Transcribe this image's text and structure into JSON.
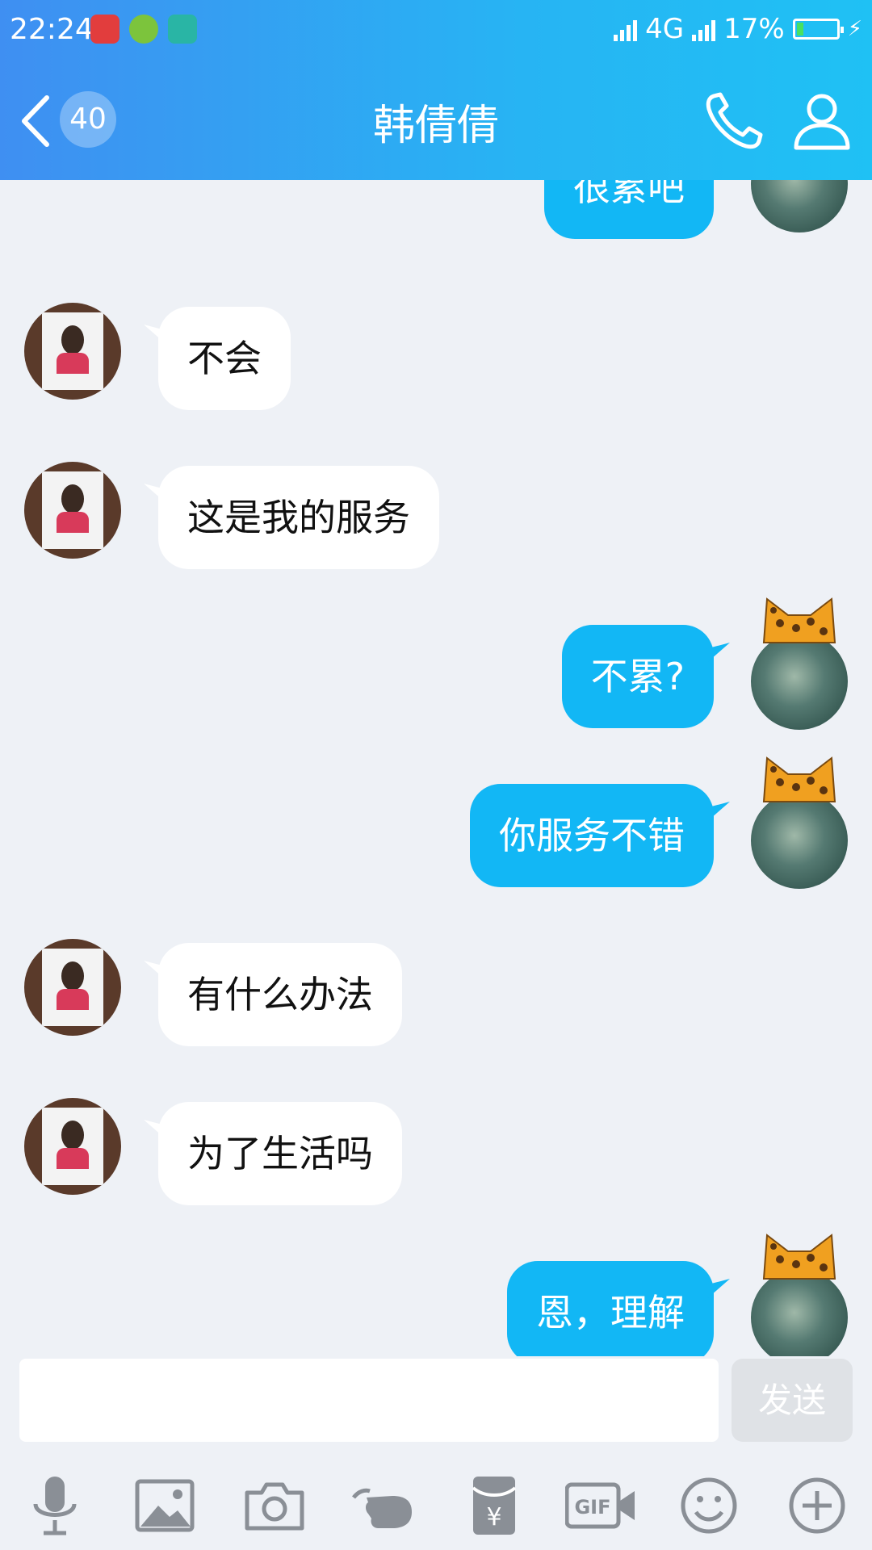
{
  "status_bar": {
    "time": "22:24",
    "network_label": "4G",
    "battery_percent": "17%",
    "battery_level": 0.17
  },
  "nav": {
    "unread_count": "40",
    "title": "韩倩倩"
  },
  "messages": [
    {
      "side": "out",
      "text": "很累吧"
    },
    {
      "side": "in",
      "text": "不会"
    },
    {
      "side": "in",
      "text": "这是我的服务"
    },
    {
      "side": "out",
      "text": "不累?"
    },
    {
      "side": "out",
      "text": "你服务不错"
    },
    {
      "side": "in",
      "text": "有什么办法"
    },
    {
      "side": "in",
      "text": "为了生活吗"
    },
    {
      "side": "out",
      "text": "恩，理解"
    }
  ],
  "input": {
    "value": "",
    "send_label": "发送"
  },
  "toolbar": {
    "items": [
      "microphone-icon",
      "image-icon",
      "camera-icon",
      "poke-icon",
      "red-packet-icon",
      "gif-icon",
      "emoji-icon",
      "plus-icon"
    ]
  },
  "colors": {
    "header_start": "#3f8ff2",
    "header_end": "#1fc1f4",
    "outgoing_bubble": "#12b7f5",
    "chat_background": "#eef1f6"
  }
}
